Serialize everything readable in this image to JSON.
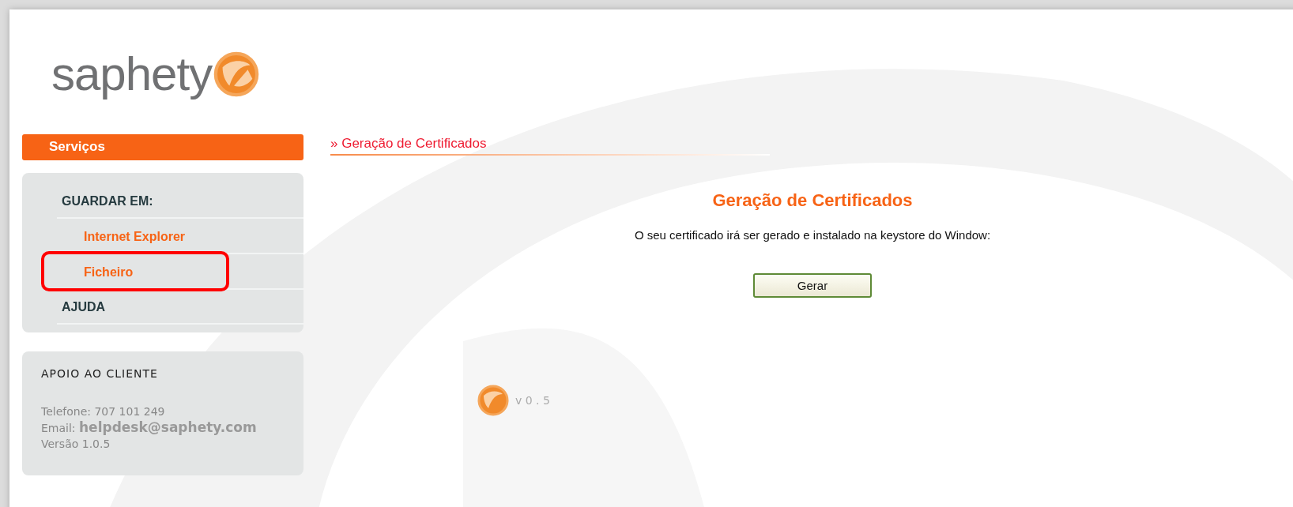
{
  "logo": {
    "text": "saphety"
  },
  "sidebar": {
    "header": "Serviços",
    "menu": [
      {
        "label": "GUARDAR EM:",
        "children": [
          {
            "label": "Internet Explorer",
            "highlighted": false
          },
          {
            "label": "Ficheiro",
            "highlighted": true
          }
        ]
      },
      {
        "label": "AJUDA"
      }
    ],
    "support": {
      "title": "APOIO AO CLIENTE",
      "phone": "Telefone: 707 101 249",
      "email_label": "Email:",
      "email": "helpdesk@saphety.com",
      "version": "Versão 1.0.5"
    }
  },
  "main": {
    "breadcrumb": "» Geração de Certificados",
    "title": "Geração de Certificados",
    "message": "O seu certificado irá ser gerado e instalado na keystore do Window:",
    "button": "Gerar",
    "version": "v 0 . 5"
  }
}
